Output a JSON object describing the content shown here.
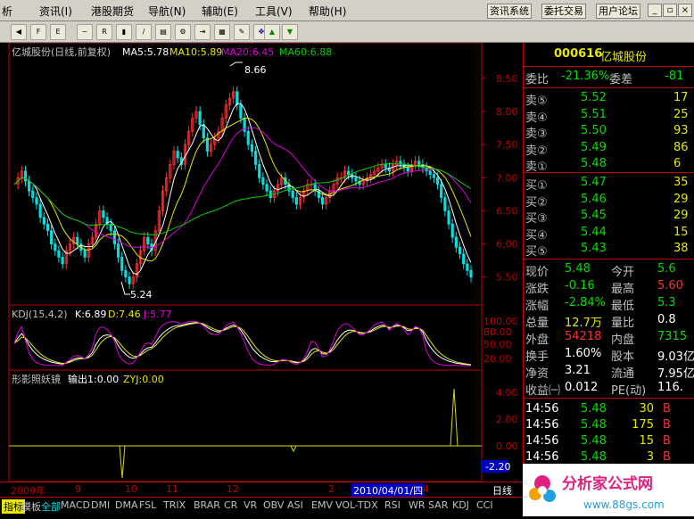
{
  "menu": {
    "items": [
      "析",
      "资讯(I)",
      "港股期货",
      "导航(N)",
      "辅助(E)",
      "工具(V)",
      "帮助(H)"
    ],
    "buttons": [
      "资讯系统",
      "委托交易",
      "用户论坛"
    ]
  },
  "chart": {
    "title": "亿城股份(日线,前复权)",
    "ma5": "MA5:5.78",
    "ma10": "MA10:5.89",
    "ma20": "MA20:6.45",
    "ma60": "MA60:6.88",
    "high_label": "8.66",
    "low_label": "5.24",
    "price_ticks": [
      "8.50",
      "8.00",
      "7.50",
      "7.00",
      "6.50",
      "6.00",
      "5.50"
    ],
    "kdj_title": "KDJ(15,4,2)",
    "kdj_k": "K:6.89",
    "kdj_d": "D:7.46",
    "kdj_j": "J:5.77",
    "kdj_ticks": [
      "100.00",
      "80.00",
      "50.00",
      "20.00"
    ],
    "ind_title": "形影照妖镜",
    "ind_out": "输出1:0.00",
    "ind_zyj": "ZYJ:0.00",
    "ind_ticks": [
      "4.00",
      "2.00",
      "0.00"
    ],
    "ind_current": "-2.20",
    "time_labels": [
      "2009年",
      "9",
      "10",
      "11",
      "12",
      "2",
      "2010/04/01/四",
      "4"
    ],
    "period": "日线"
  },
  "chart_data": {
    "type": "line",
    "title": "亿城股份(日线,前复权)",
    "price_ylim": [
      5.24,
      8.66
    ],
    "price_ticks": [
      8.5,
      8.0,
      7.5,
      7.0,
      6.5,
      6.0,
      5.5
    ],
    "series": [
      {
        "name": "MA5",
        "last": 5.78
      },
      {
        "name": "MA10",
        "last": 5.89
      },
      {
        "name": "MA20",
        "last": 6.45
      },
      {
        "name": "MA60",
        "last": 6.88
      }
    ],
    "kdj": {
      "K": 6.89,
      "D": 7.46,
      "J": 5.77
    },
    "indicator": {
      "输出1": 0.0,
      "ZYJ": 0.0,
      "current": -2.2
    }
  },
  "quote": {
    "code": "000616",
    "name": "亿城股份",
    "webi_label": "委比",
    "webi_val": "-21.36%",
    "wecha_label": "委差",
    "wecha_val": "-81",
    "sell": [
      {
        "label": "卖⑤",
        "price": "5.52",
        "vol": "17"
      },
      {
        "label": "卖④",
        "price": "5.51",
        "vol": "25"
      },
      {
        "label": "卖③",
        "price": "5.50",
        "vol": "93"
      },
      {
        "label": "卖②",
        "price": "5.49",
        "vol": "86"
      },
      {
        "label": "卖①",
        "price": "5.48",
        "vol": "6"
      }
    ],
    "buy": [
      {
        "label": "买①",
        "price": "5.47",
        "vol": "35"
      },
      {
        "label": "买②",
        "price": "5.46",
        "vol": "29"
      },
      {
        "label": "买③",
        "price": "5.45",
        "vol": "29"
      },
      {
        "label": "买④",
        "price": "5.44",
        "vol": "15"
      },
      {
        "label": "买⑤",
        "price": "5.43",
        "vol": "38"
      }
    ],
    "stats": [
      {
        "l1": "现价",
        "v1": "5.48",
        "l2": "今开",
        "v2": "5.6"
      },
      {
        "l1": "涨跌",
        "v1": "-0.16",
        "l2": "最高",
        "v2": "5.60"
      },
      {
        "l1": "涨幅",
        "v1": "-2.84%",
        "l2": "最低",
        "v2": "5.3"
      },
      {
        "l1": "总量",
        "v1": "12.7万",
        "l2": "量比",
        "v2": "0.8"
      },
      {
        "l1": "外盘",
        "v1": "54218",
        "l2": "内盘",
        "v2": "7315"
      },
      {
        "l1": "换手",
        "v1": "1.60%",
        "l2": "股本",
        "v2": "9.03亿"
      },
      {
        "l1": "净资",
        "v1": "3.21",
        "l2": "流通",
        "v2": "7.95亿"
      },
      {
        "l1": "收益㈠",
        "v1": "0.012",
        "l2": "PE(动)",
        "v2": "116."
      }
    ],
    "ticks": [
      {
        "time": "14:56",
        "price": "5.48",
        "vol": "30",
        "bs": "B"
      },
      {
        "time": "14:56",
        "price": "5.48",
        "vol": "175",
        "bs": "B"
      },
      {
        "time": "14:56",
        "price": "5.48",
        "vol": "15",
        "bs": "B"
      },
      {
        "time": "14:56",
        "price": "5.48",
        "vol": "3",
        "bs": "B"
      }
    ]
  },
  "tabs": [
    "指标",
    "模板",
    "全部",
    "MACD",
    "DMI",
    "DMA",
    "FSL",
    "TRIX",
    "BRAR",
    "CR",
    "VR",
    "OBV",
    "ASI",
    "EMV",
    "VOL-TDX",
    "RSI",
    "WR",
    "SAR",
    "KDJ",
    "CCI"
  ],
  "logo": {
    "text": "分析家公式网",
    "url": "www.88gs.com"
  }
}
